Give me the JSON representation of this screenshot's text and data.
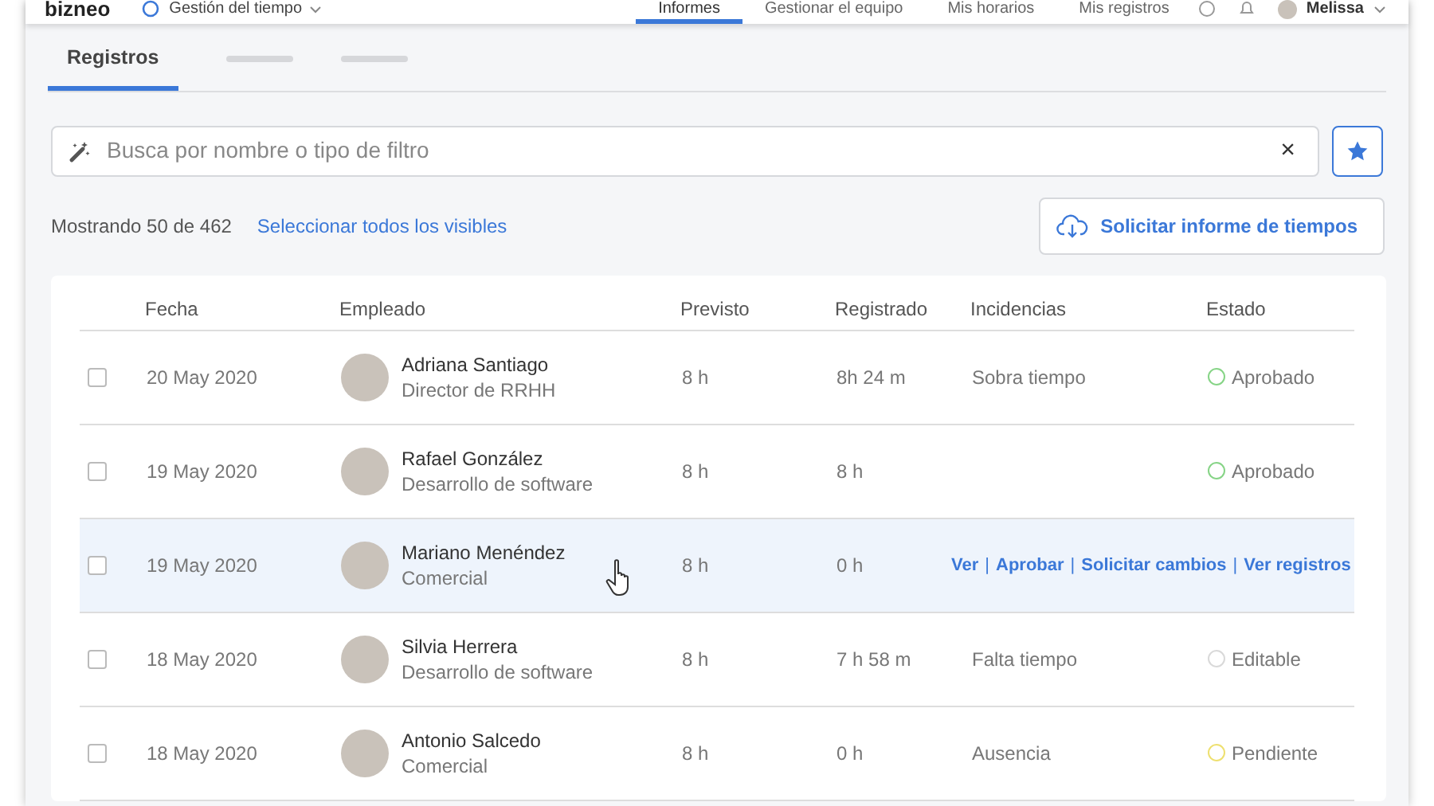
{
  "header": {
    "logo": "bizneo",
    "module": "Gestión del tiempo",
    "nav": [
      {
        "label": "Informes",
        "selected": true
      },
      {
        "label": "Gestionar el equipo",
        "selected": false
      },
      {
        "label": "Mis horarios",
        "selected": false
      },
      {
        "label": "Mis registros",
        "selected": false
      }
    ],
    "user": "Melissa"
  },
  "tabs": [
    {
      "kind": "label",
      "label": "Registros",
      "selected": true
    },
    {
      "kind": "placeholder",
      "selected": false
    },
    {
      "kind": "placeholder",
      "selected": false
    }
  ],
  "search": {
    "placeholder": "Busca por nombre o tipo de filtro",
    "clear": "×"
  },
  "summary": "Mostrando 50 de 462",
  "select_all_link": "Seleccionar todos los visibles",
  "report_button": "Solicitar informe de tiempos",
  "table": {
    "columns": [
      "Fecha",
      "Empleado",
      "Previsto",
      "Registrado",
      "Incidencias",
      "Estado"
    ],
    "separator": "|",
    "rows": [
      {
        "checked": false,
        "hovered": false,
        "date": "20 May 2020",
        "name": "Adriana Santiago",
        "role": "Director de RRHH",
        "planned": "8 h",
        "recorded": "8h 24 m",
        "incident": "Sobra tiempo",
        "status": "Aprobado",
        "color": "#86d486"
      },
      {
        "checked": false,
        "hovered": false,
        "date": "19 May 2020",
        "name": "Rafael González",
        "role": "Desarrollo de software",
        "planned": "8 h",
        "recorded": "8 h",
        "status": "Aprobado",
        "color": "#86d486"
      },
      {
        "checked": false,
        "hovered": true,
        "date": "19 May 2020",
        "name": "Mariano Menéndez",
        "role": "Comercial",
        "planned": "8 h",
        "recorded": "0 h",
        "actions": [
          "Ver",
          "Aprobar",
          "Solicitar cambios",
          "Ver registros"
        ]
      },
      {
        "checked": false,
        "hovered": false,
        "date": "18 May 2020",
        "name": "Silvia Herrera",
        "role": "Desarrollo de software",
        "planned": "8 h",
        "recorded": "7 h 58 m",
        "incident": "Falta tiempo",
        "status": "Editable",
        "color": "#d9d9d9"
      },
      {
        "checked": false,
        "hovered": false,
        "date": "18 May 2020",
        "name": "Antonio Salcedo",
        "role": "Comercial",
        "planned": "8 h",
        "recorded": "0 h",
        "incident": "Ausencia",
        "status": "Pendiente",
        "color": "#eee070"
      }
    ]
  }
}
